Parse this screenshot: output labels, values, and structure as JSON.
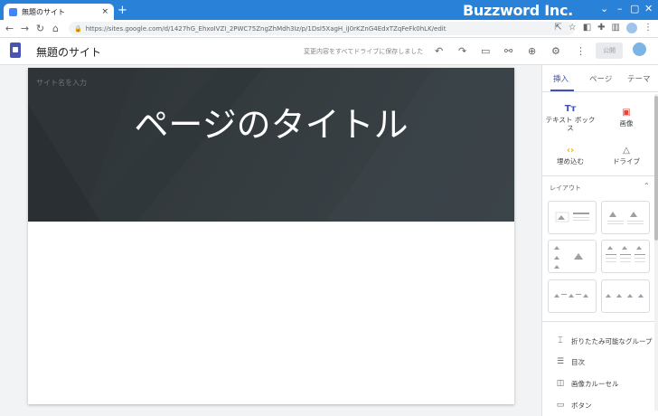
{
  "browser": {
    "tab_title": "無題のサイト",
    "tab_close": "×",
    "new_tab": "+",
    "url": "https://sites.google.com/d/1427hG_EhxoIVZI_2PWC75ZngZhMdh3Iz/p/1DsI5XagH_iJ0rKZnG4EdxTZqFeFk0hLK/edit",
    "overlay_brand": "Buzzword Inc.",
    "colors": {
      "tabstrip": "#2a81d8",
      "omnibox": "#f1f3f4"
    }
  },
  "app": {
    "site_name": "無題のサイト",
    "save_status": "変更内容をすべてドライブに保存しました",
    "publish_label": "公開",
    "colors": {
      "accent": "#3f51b5",
      "logo": "#4a55b3"
    }
  },
  "page": {
    "site_name_placeholder": "サイト名を入力",
    "title": "ページのタイトル",
    "colors": {
      "hero": "#2b3134"
    }
  },
  "panel": {
    "tabs": [
      {
        "label": "挿入",
        "active": true
      },
      {
        "label": "ページ",
        "active": false
      },
      {
        "label": "テーマ",
        "active": false
      }
    ],
    "insert_items": [
      {
        "label": "テキスト ボックス",
        "icon": "text-box-icon",
        "glyph": "Tт"
      },
      {
        "label": "画像",
        "icon": "image-icon",
        "glyph": "▣"
      },
      {
        "label": "埋め込む",
        "icon": "embed-icon",
        "glyph": "‹›"
      },
      {
        "label": "ドライブ",
        "icon": "drive-icon",
        "glyph": "△"
      }
    ],
    "layout_label": "レイアウト",
    "components": [
      {
        "label": "折りたたみ可能なグループ",
        "icon": "collapsible-group-icon",
        "glyph": "⌶"
      },
      {
        "label": "目次",
        "icon": "table-of-contents-icon",
        "glyph": "☰"
      },
      {
        "label": "画像カルーセル",
        "icon": "carousel-icon",
        "glyph": "◫"
      },
      {
        "label": "ボタン",
        "icon": "button-icon",
        "glyph": "▭"
      }
    ]
  }
}
